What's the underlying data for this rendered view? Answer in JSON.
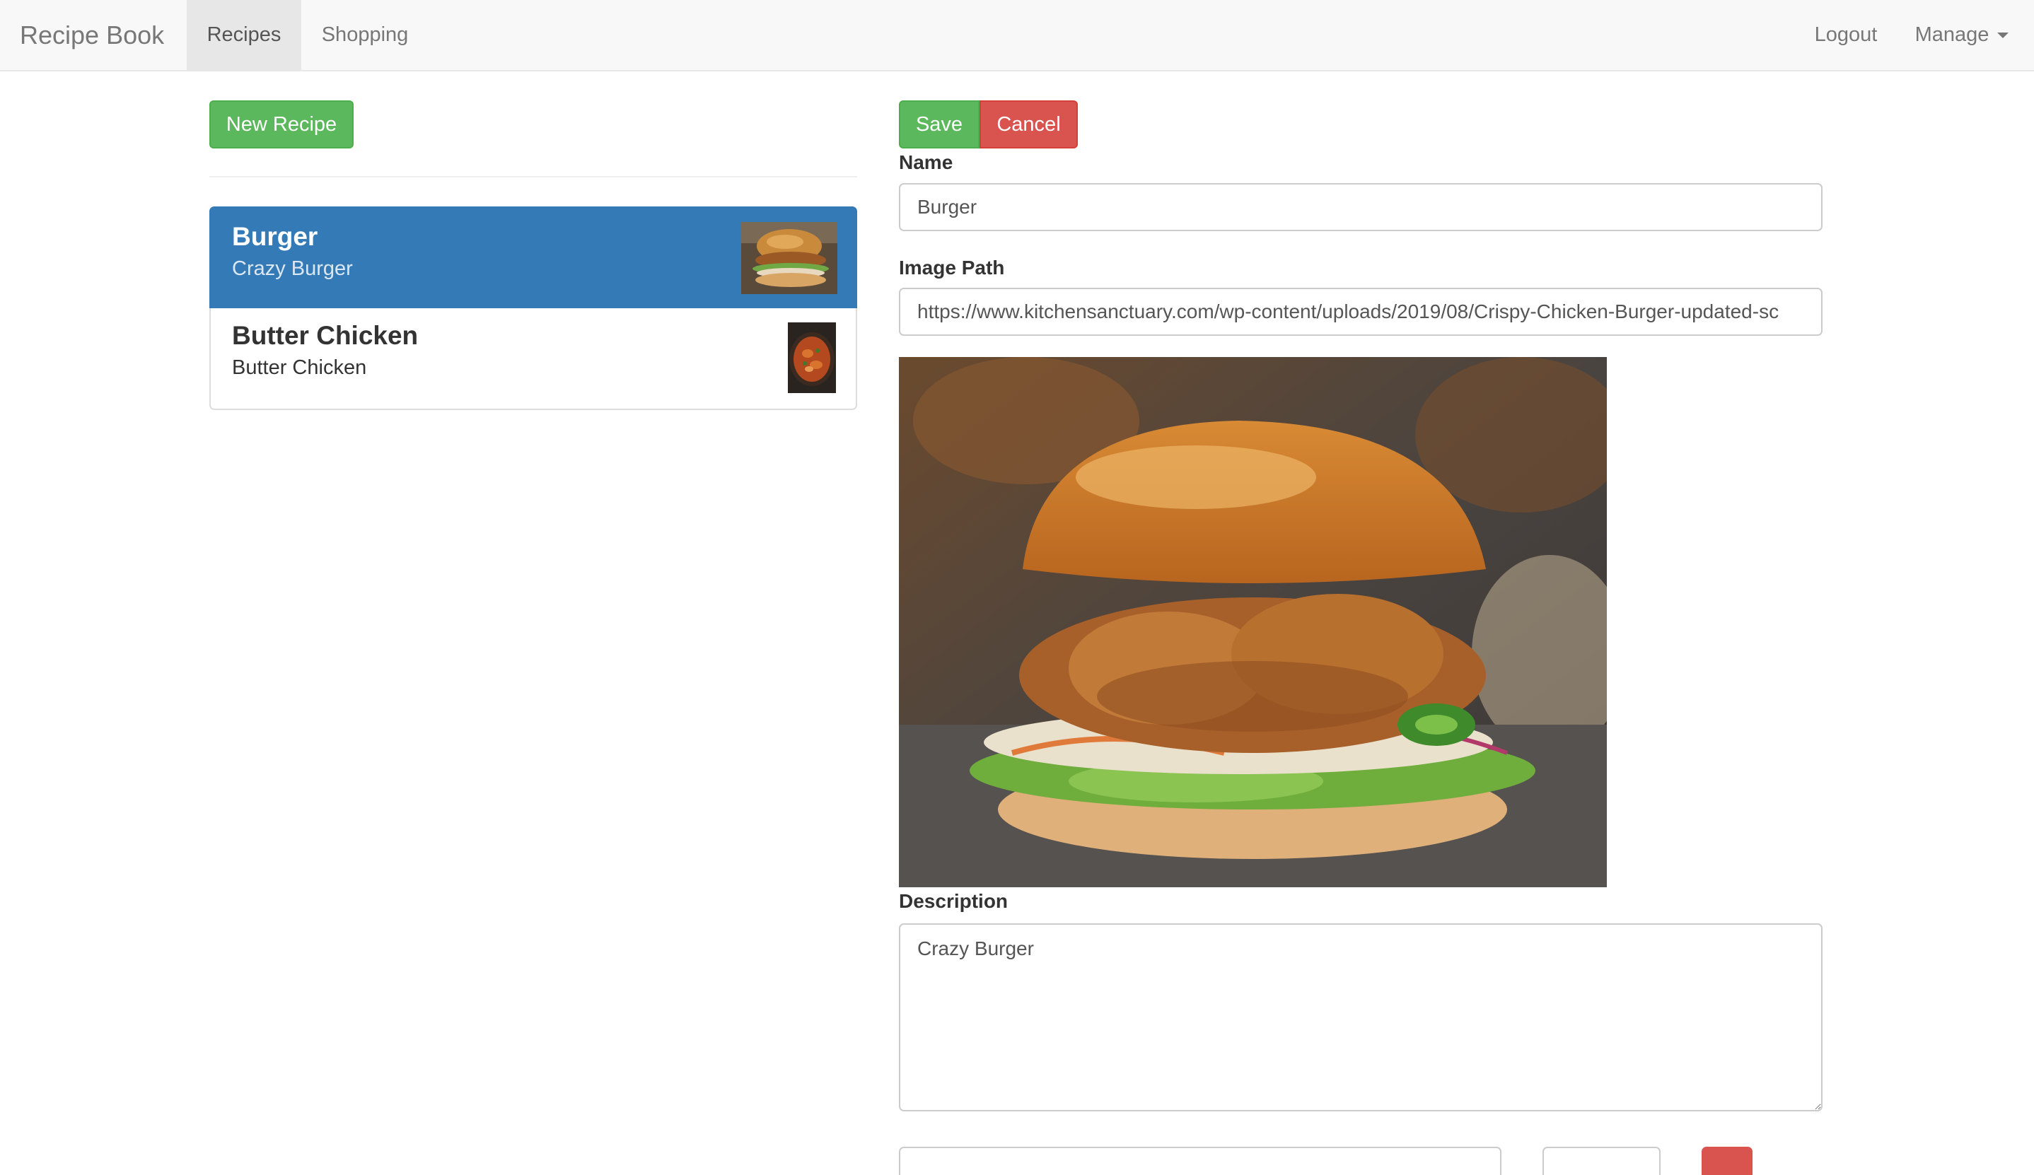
{
  "navbar": {
    "brand": "Recipe Book",
    "tabs": [
      {
        "label": "Recipes",
        "active": true
      },
      {
        "label": "Shopping",
        "active": false
      }
    ],
    "logout_label": "Logout",
    "manage_label": "Manage"
  },
  "sidebar": {
    "new_recipe_label": "New Recipe",
    "recipes": [
      {
        "name": "Burger",
        "description": "Crazy Burger",
        "active": true
      },
      {
        "name": "Butter Chicken",
        "description": "Butter Chicken",
        "active": false
      }
    ]
  },
  "editor": {
    "save_label": "Save",
    "cancel_label": "Cancel",
    "name_label": "Name",
    "name_value": "Burger",
    "image_path_label": "Image Path",
    "image_path_value": "https://www.kitchensanctuary.com/wp-content/uploads/2019/08/Crispy-Chicken-Burger-updated-sc",
    "description_label": "Description",
    "description_value": "Crazy Burger"
  },
  "colors": {
    "success": "#5cb85c",
    "danger": "#d9534f",
    "active_item": "#337ab7",
    "navbar_bg": "#f8f8f8"
  }
}
